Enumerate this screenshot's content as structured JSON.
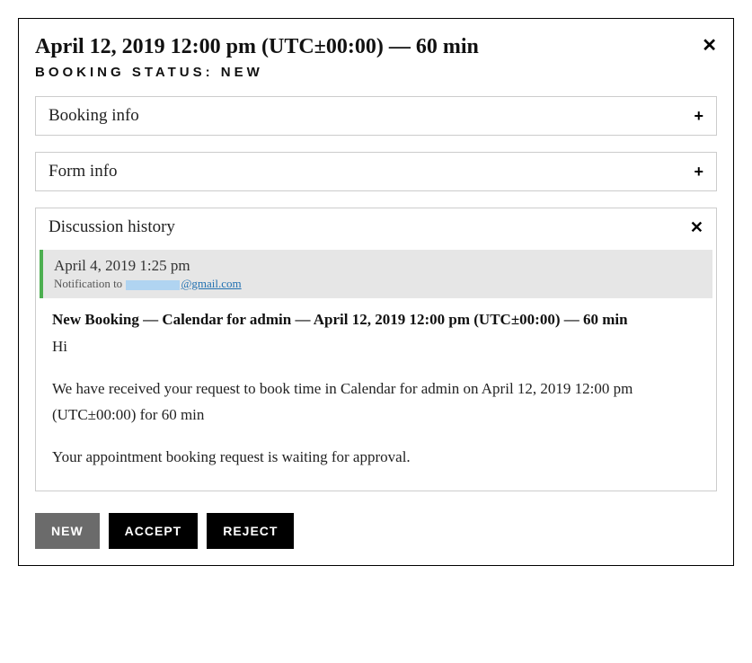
{
  "header": {
    "title": "April 12, 2019 12:00 pm (UTC±00:00) — 60 min",
    "subtitle": "BOOKING STATUS: NEW"
  },
  "accordions": {
    "booking_info": {
      "label": "Booking info"
    },
    "form_info": {
      "label": "Form info"
    },
    "discussion": {
      "label": "Discussion history"
    }
  },
  "discussion_entry": {
    "date": "April 4, 2019 1:25 pm",
    "notif_prefix": "Notification to ",
    "notif_domain": "@gmail.com"
  },
  "message": {
    "subject": "New Booking — Calendar for admin — April 12, 2019 12:00 pm (UTC±00:00) — 60 min",
    "greeting": "Hi",
    "body1": "We have received your request to book time in Calendar for admin on April 12, 2019 12:00 pm (UTC±00:00) for 60 min",
    "body2": "Your appointment booking request is waiting for approval."
  },
  "buttons": {
    "new": "New",
    "accept": "Accept",
    "reject": "Reject"
  }
}
